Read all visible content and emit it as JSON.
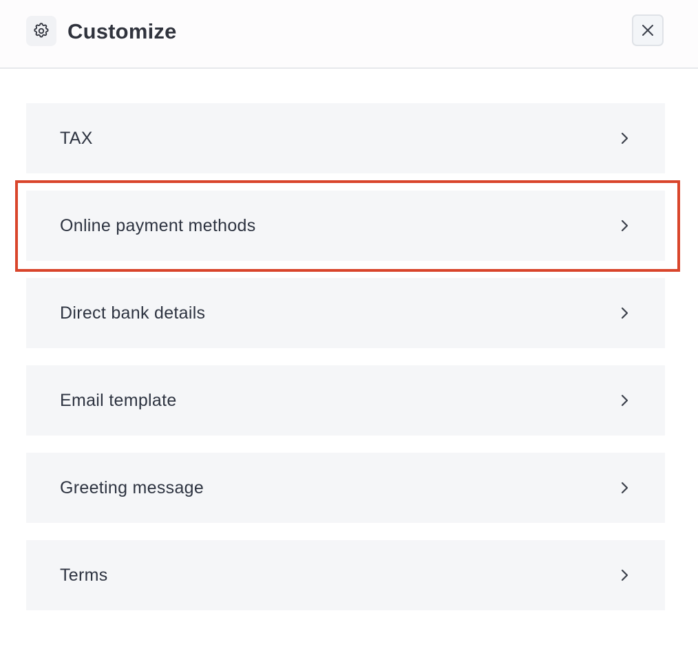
{
  "header": {
    "icon": "gear-icon",
    "title": "Customize",
    "close_icon": "close-icon"
  },
  "menu": {
    "items": [
      {
        "label": "TAX",
        "icon": "chevron-right-icon"
      },
      {
        "label": "Online payment methods",
        "icon": "chevron-right-icon",
        "highlighted": true
      },
      {
        "label": "Direct bank details",
        "icon": "chevron-right-icon"
      },
      {
        "label": "Email template",
        "icon": "chevron-right-icon"
      },
      {
        "label": "Greeting message",
        "icon": "chevron-right-icon"
      },
      {
        "label": "Terms",
        "icon": "chevron-right-icon"
      }
    ]
  },
  "colors": {
    "highlight": "#d9452b",
    "item_background": "#f5f6f8",
    "text": "#2d3340"
  }
}
